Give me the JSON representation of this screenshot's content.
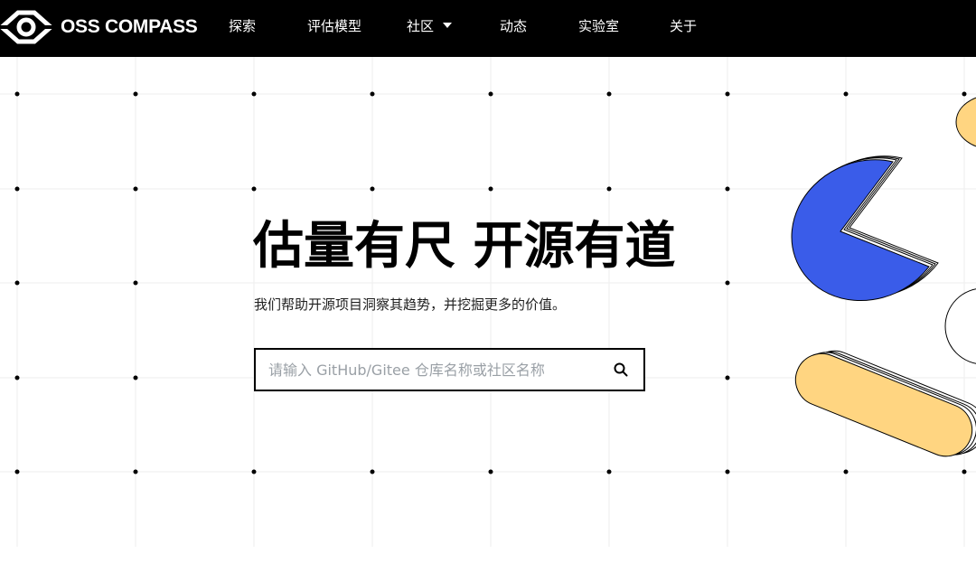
{
  "brand": {
    "name": "OSS COMPASS",
    "logo_icon": "eye-compass-logo-icon"
  },
  "nav": {
    "items": [
      {
        "label": "探索"
      },
      {
        "label": "评估模型"
      },
      {
        "label": "社区",
        "has_dropdown": true
      },
      {
        "label": "动态"
      },
      {
        "label": "实验室"
      },
      {
        "label": "关于"
      }
    ]
  },
  "hero": {
    "title": "估量有尺 开源有道",
    "subtitle": "我们帮助开源项目洞察其趋势，并挖掘更多的价值。",
    "search": {
      "placeholder": "请输入 GitHub/Gitee 仓库名称或社区名称",
      "value": "",
      "icon": "search-icon"
    }
  },
  "colors": {
    "navbar_bg": "#000000",
    "pie_blue": "#3a5ce9",
    "capsule_yellow": "#ffd581",
    "grid_line": "#eeeeee",
    "grid_dot": "#000000"
  }
}
